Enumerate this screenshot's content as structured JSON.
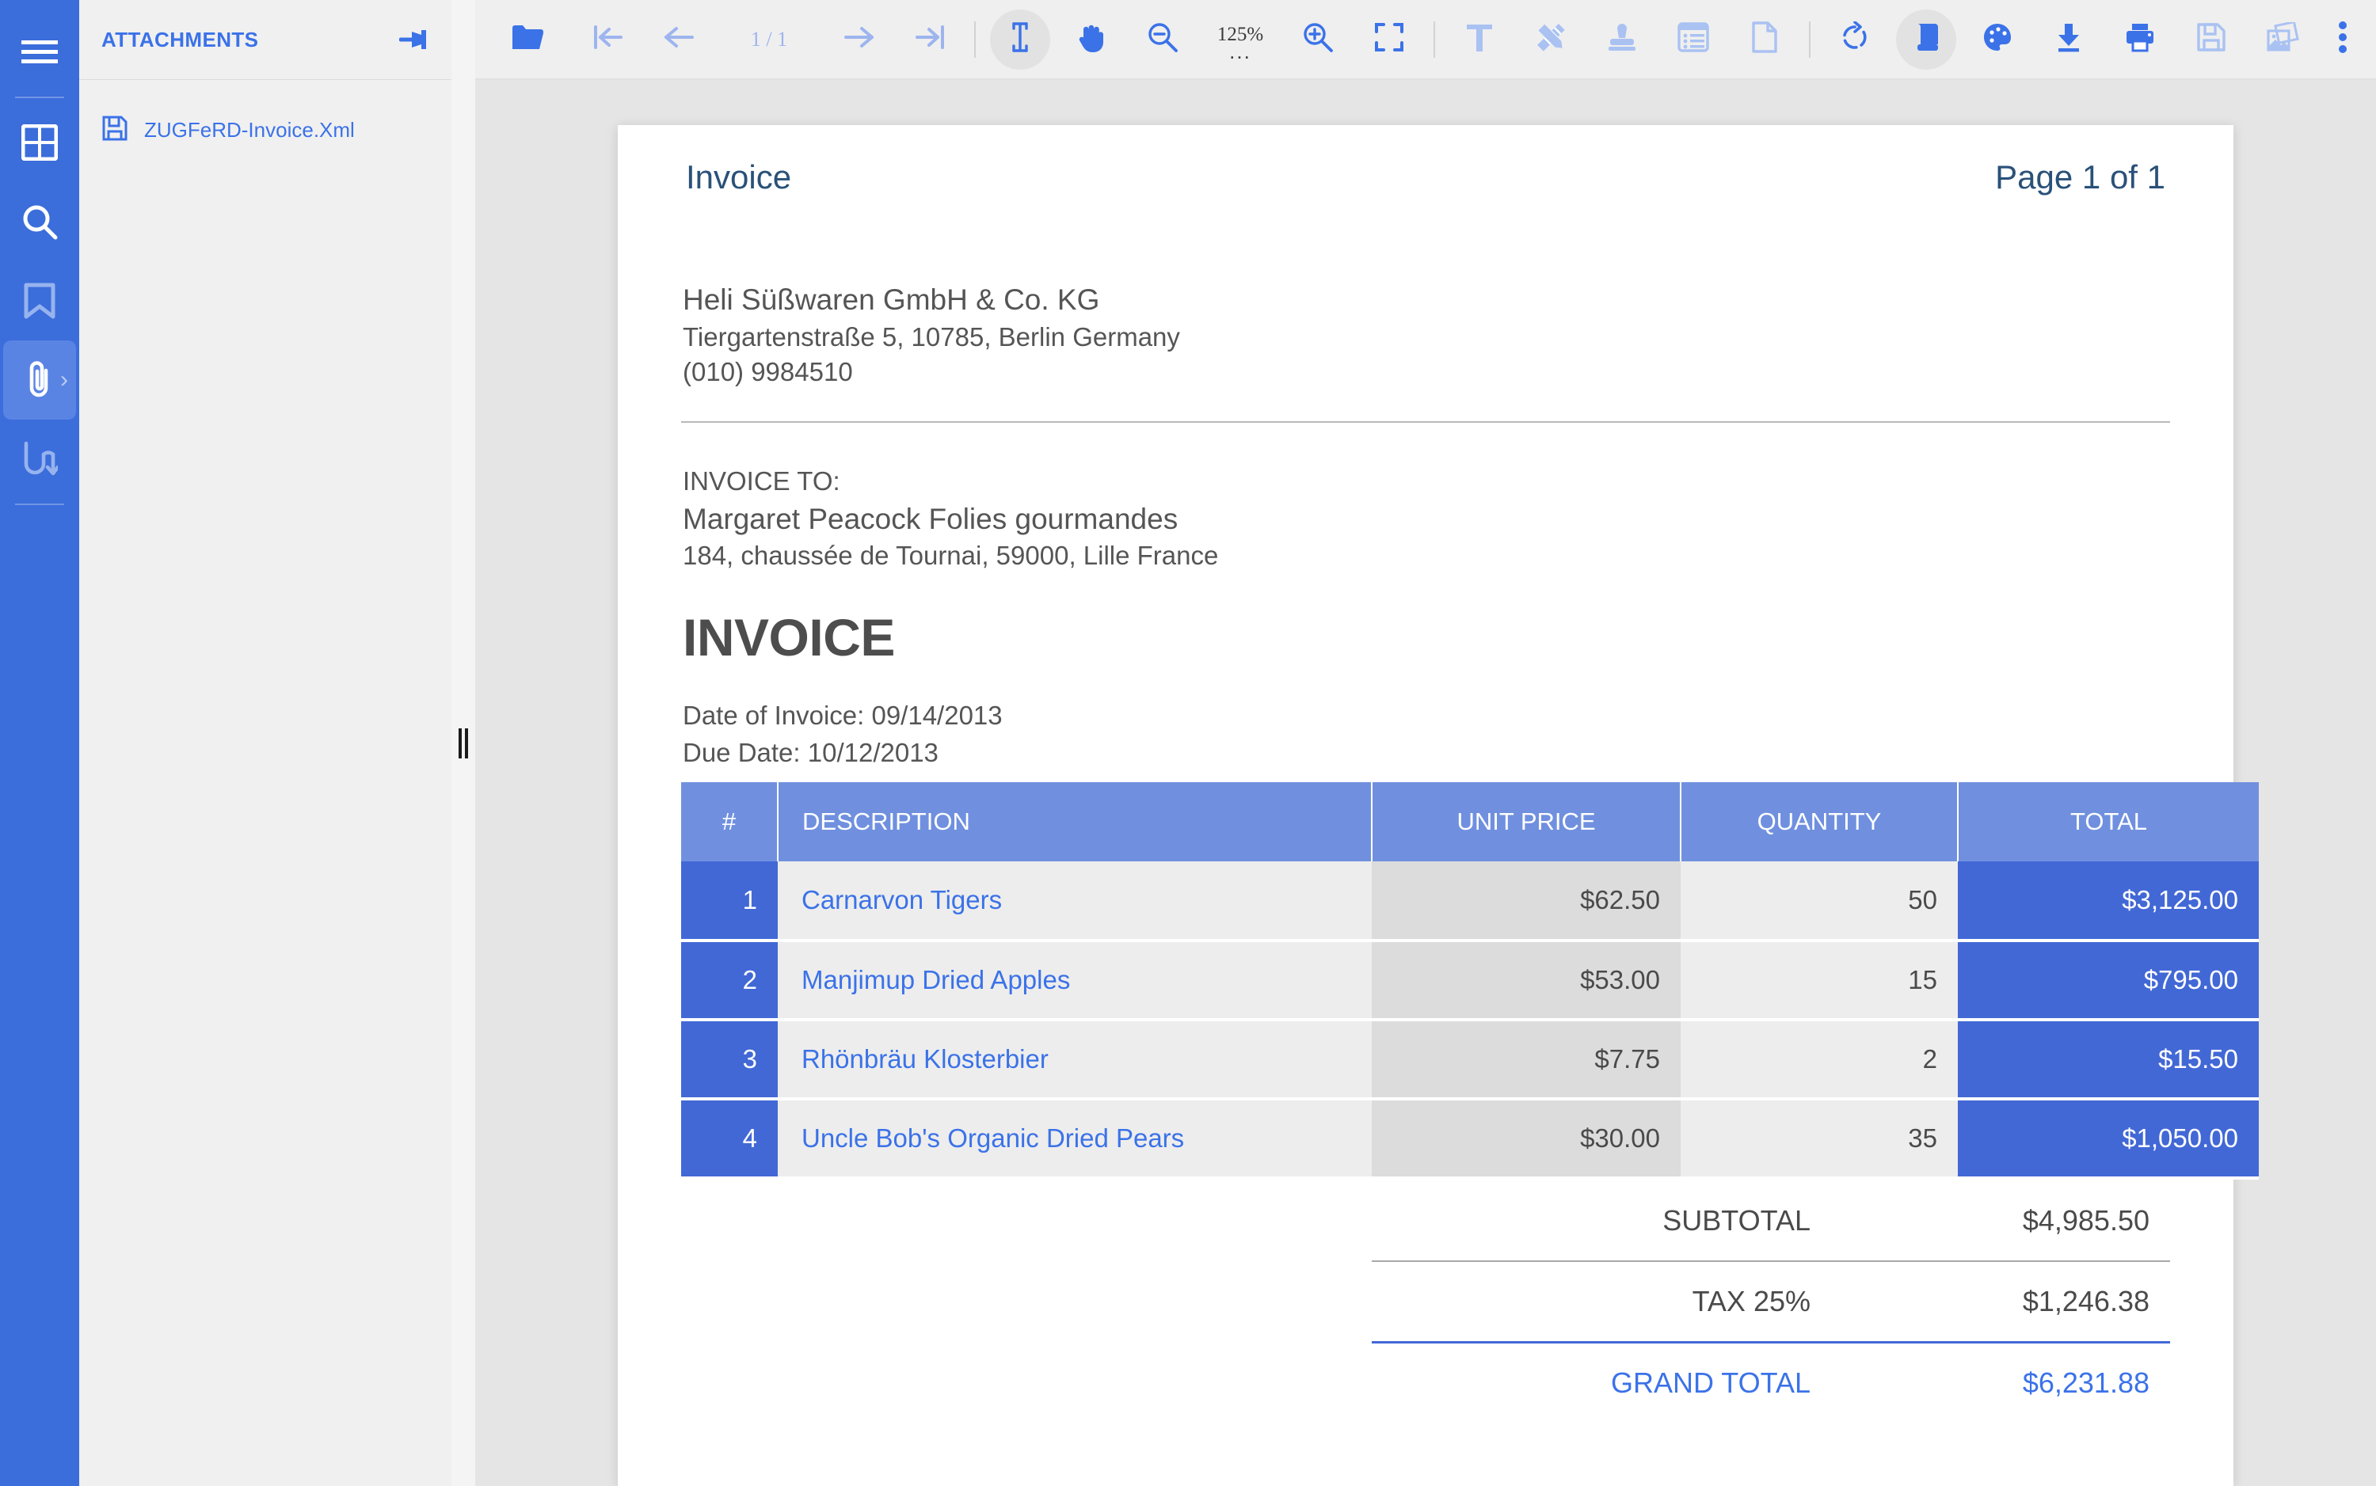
{
  "rail": {
    "items": [
      {
        "name": "menu",
        "icon": "hamburger-menu-icon",
        "state": "normal"
      },
      {
        "name": "thumbnails",
        "icon": "grid-thumbnails-icon",
        "state": "normal"
      },
      {
        "name": "search",
        "icon": "search-icon",
        "state": "normal"
      },
      {
        "name": "bookmarks",
        "icon": "bookmark-icon",
        "state": "dimmed"
      },
      {
        "name": "attachments",
        "icon": "paperclip-icon",
        "state": "active"
      },
      {
        "name": "signature",
        "icon": "signature-flow-icon",
        "state": "dimmed"
      }
    ]
  },
  "panel": {
    "title": "ATTACHMENTS",
    "pin_icon": "pin-icon",
    "attachments": [
      {
        "icon": "floppy-save-icon",
        "name": "ZUGFeRD-Invoice.Xml"
      }
    ]
  },
  "toolbar": {
    "open_file": "open-folder-icon",
    "first_page": "first-page-icon",
    "prev_page": "previous-page-icon",
    "page_indicator": "1 / 1",
    "next_page": "next-page-icon",
    "last_page": "last-page-icon",
    "text_select": "text-cursor-icon",
    "pan": "hand-pan-icon",
    "zoom_out": "zoom-out-icon",
    "zoom_value": "125%",
    "zoom_more": "...",
    "zoom_in": "zoom-in-icon",
    "fit_screen": "fit-to-screen-icon",
    "text_tool": "text-tool-icon",
    "markup_tool": "pencil-ruler-icon",
    "stamp_tool": "stamp-icon",
    "form_tool": "form-list-icon",
    "page_tool": "page-document-icon",
    "rotate": "rotate-clockwise-icon",
    "scroll_mode": "scroll-mode-icon",
    "theme": "palette-icon",
    "download": "download-icon",
    "print": "print-icon",
    "save": "floppy-save-icon",
    "images": "images-gallery-icon",
    "more": "more-vertical-icon"
  },
  "document": {
    "header_left": "Invoice",
    "header_right": "Page 1 of 1",
    "company": {
      "name": "Heli Süßwaren GmbH & Co. KG",
      "address": "Tiergartenstraße 5, 10785, Berlin Germany",
      "phone": "(010) 9984510"
    },
    "bill_to": {
      "label": "INVOICE TO:",
      "name": "Margaret Peacock Folies gourmandes",
      "address": "184, chaussée de Tournai, 59000, Lille France"
    },
    "title": "INVOICE",
    "date_of_invoice": "Date of Invoice: 09/14/2013",
    "due_date": "Due Date: 10/12/2013",
    "table": {
      "columns": [
        "#",
        "DESCRIPTION",
        "UNIT PRICE",
        "QUANTITY",
        "TOTAL"
      ],
      "rows": [
        {
          "num": "1",
          "description": "Carnarvon Tigers",
          "unit_price": "$62.50",
          "quantity": "50",
          "total": "$3,125.00"
        },
        {
          "num": "2",
          "description": "Manjimup Dried Apples",
          "unit_price": "$53.00",
          "quantity": "15",
          "total": "$795.00"
        },
        {
          "num": "3",
          "description": "Rhönbräu Klosterbier",
          "unit_price": "$7.75",
          "quantity": "2",
          "total": "$15.50"
        },
        {
          "num": "4",
          "description": "Uncle Bob's Organic Dried Pears",
          "unit_price": "$30.00",
          "quantity": "35",
          "total": "$1,050.00"
        }
      ]
    },
    "totals": {
      "subtotal_label": "SUBTOTAL",
      "subtotal_value": "$4,985.50",
      "tax_label": "TAX 25%",
      "tax_value": "$1,246.38",
      "grand_label": "GRAND TOTAL",
      "grand_value": "$6,231.88"
    }
  },
  "colors": {
    "rail_blue": "#3b6ddb",
    "accent_blue": "#3b72e8",
    "table_header_blue": "#7090df",
    "table_total_blue": "#4268d6",
    "doc_heading": "#2a5179"
  }
}
